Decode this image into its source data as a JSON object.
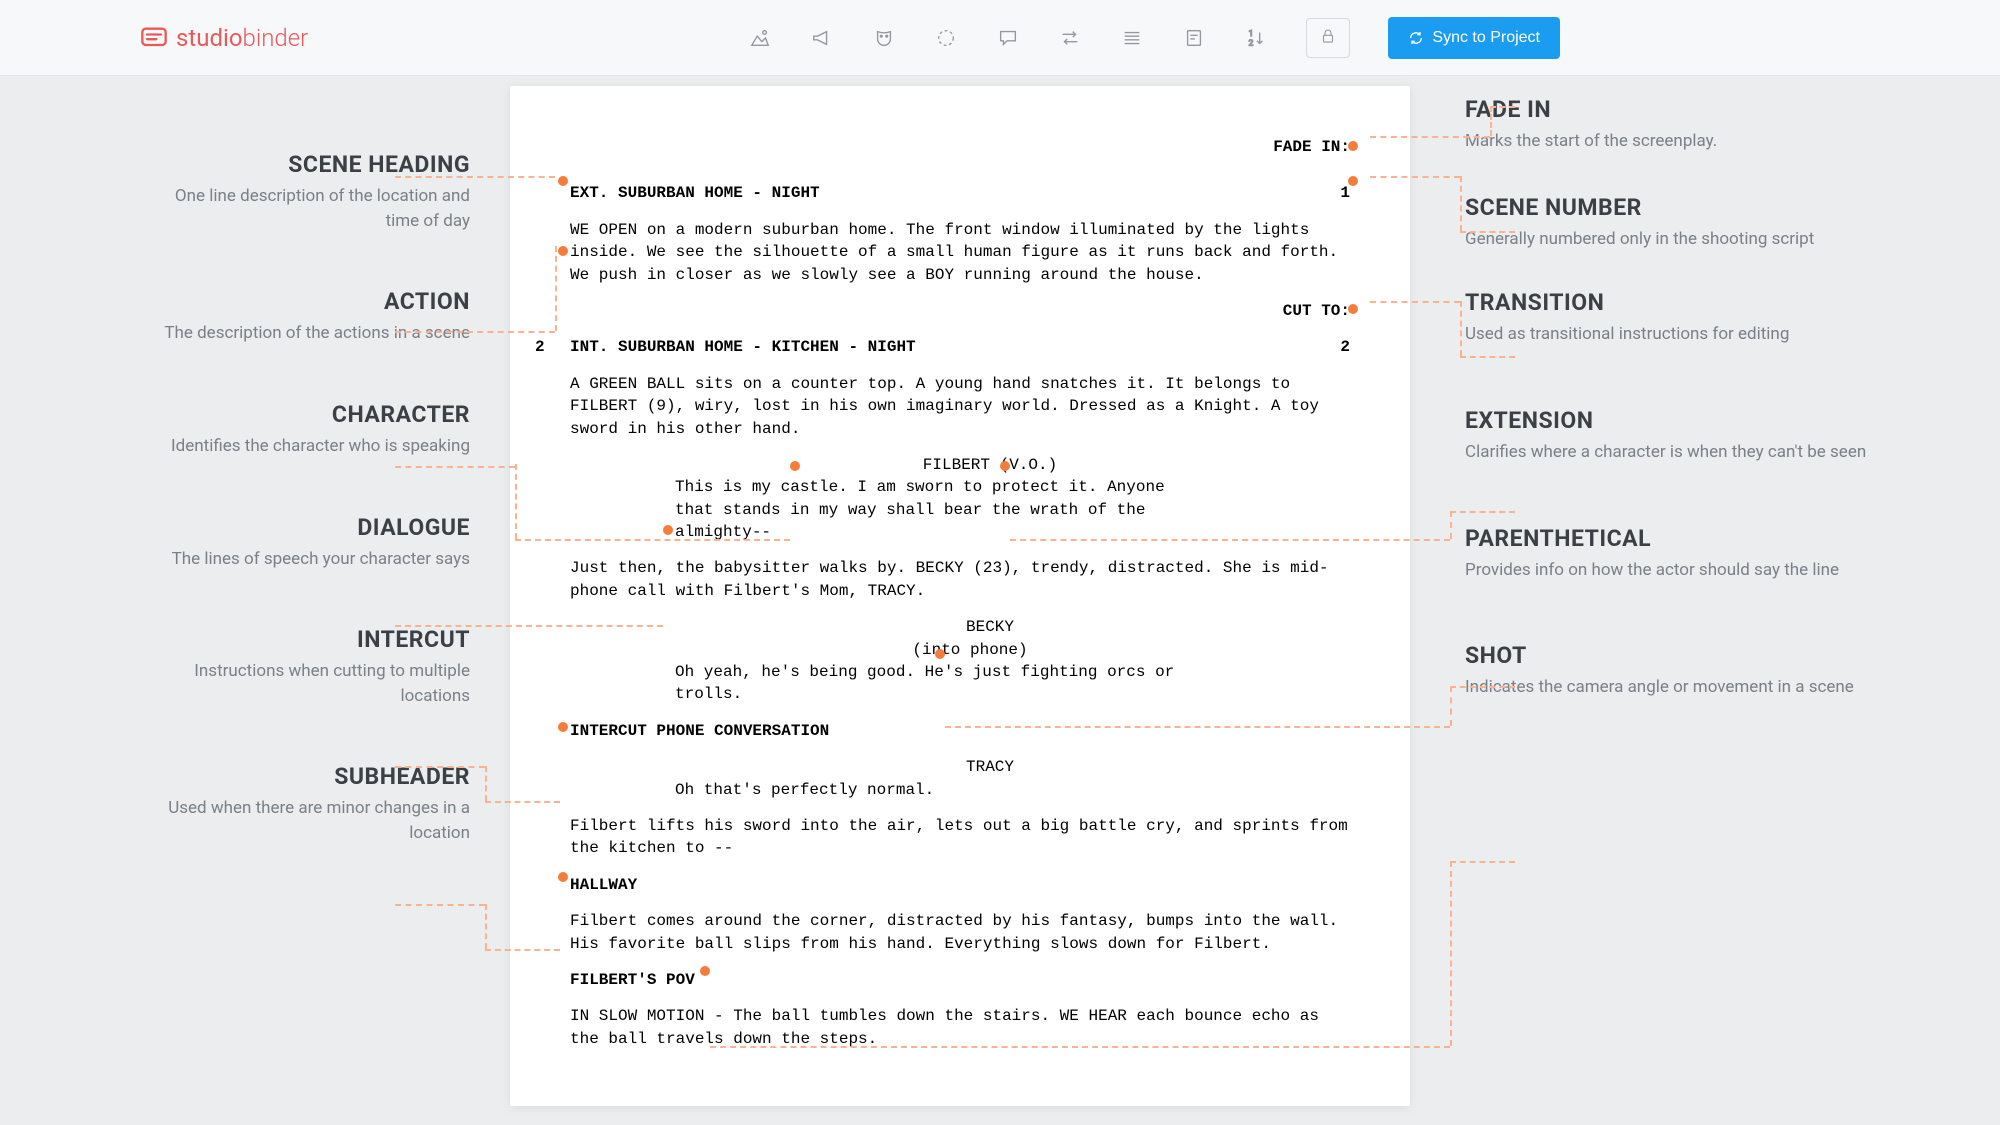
{
  "header": {
    "logo_prefix": "studio",
    "logo_suffix": "binder",
    "sync_label": "Sync to Project"
  },
  "left_labels": [
    {
      "title": "SCENE HEADING",
      "desc": "One line description of the location and time of day"
    },
    {
      "title": "ACTION",
      "desc": "The description of the actions in a scene"
    },
    {
      "title": "CHARACTER",
      "desc": "Identifies the character who is speaking"
    },
    {
      "title": "DIALOGUE",
      "desc": "The lines of speech your character says"
    },
    {
      "title": "INTERCUT",
      "desc": "Instructions when cutting to multiple locations"
    },
    {
      "title": "SUBHEADER",
      "desc": "Used when there are minor changes in a location"
    }
  ],
  "right_labels": [
    {
      "title": "FADE IN",
      "desc": "Marks the start of the screenplay."
    },
    {
      "title": "SCENE NUMBER",
      "desc": "Generally numbered only in the shooting script"
    },
    {
      "title": "TRANSITION",
      "desc": "Used as transitional instructions for editing"
    },
    {
      "title": "EXTENSION",
      "desc": "Clarifies where a character is when they can't be seen"
    },
    {
      "title": "PARENTHETICAL",
      "desc": "Provides info on how the actor should say the line"
    },
    {
      "title": "SHOT",
      "desc": "Indicates the camera angle or movement in a scene"
    }
  ],
  "script": {
    "fade_in": "FADE IN:",
    "scene1_num": "1",
    "scene1": "EXT. SUBURBAN HOME - NIGHT",
    "action1": "WE OPEN on a modern suburban home. The front window illuminated by the lights inside. We see the silhouette of a small human figure as it runs back and forth. We push in closer as we slowly see a BOY running around the house.",
    "trans1": "CUT TO:",
    "scene2_num": "2",
    "scene2": "INT. SUBURBAN HOME - KITCHEN - NIGHT",
    "action2": "A GREEN BALL sits on a counter top. A young hand snatches it. It belongs to FILBERT (9), wiry, lost in his own imaginary world. Dressed as a Knight. A toy sword in his other hand.",
    "char1": "FILBERT (V.O.)",
    "dial1": "This is my castle. I am sworn to protect it. Anyone that stands in my way shall bear the wrath of the almighty--",
    "action3": "Just then, the babysitter walks by. BECKY (23), trendy, distracted. She is mid-phone call with Filbert's Mom, TRACY.",
    "char2": "BECKY",
    "paren1": "(into phone)",
    "dial2": "Oh yeah, he's being good. He's just fighting orcs or trolls.",
    "intercut": "INTERCUT PHONE CONVERSATION",
    "char3": "TRACY",
    "dial3": "Oh that's perfectly normal.",
    "action4": "Filbert lifts his sword into the air, lets out a big battle cry, and sprints from the kitchen to --",
    "sub1": "HALLWAY",
    "action5": "Filbert comes around the corner, distracted by his fantasy, bumps into the wall. His favorite ball slips from his hand. Everything slows down for Filbert.",
    "shot1": "FILBERT'S POV",
    "action6": "IN SLOW MOTION - The ball tumbles down the stairs. WE HEAR each bounce echo as the ball travels down the steps."
  }
}
